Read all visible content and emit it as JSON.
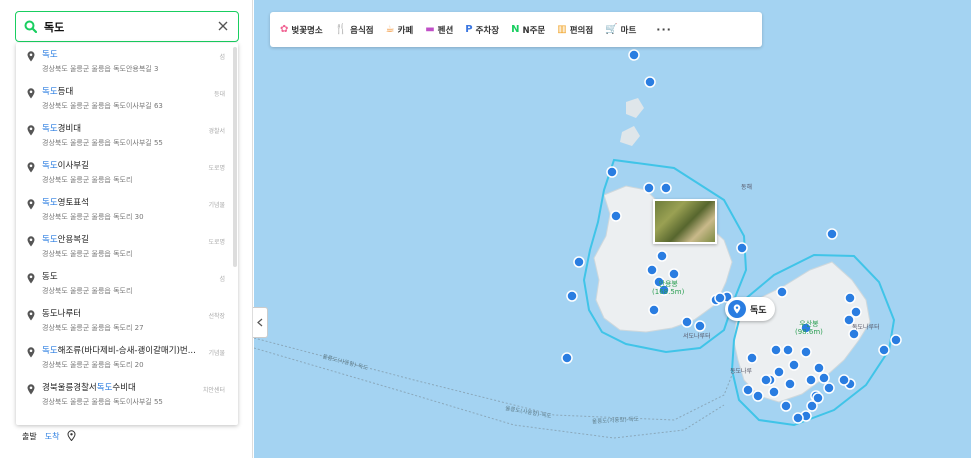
{
  "search": {
    "value": "독도"
  },
  "suggestions": [
    {
      "hl": "독도",
      "rest": "",
      "addr": "경상북도 울릉군 울릉읍 독도안용복길 3",
      "cat": "섬"
    },
    {
      "hl": "독도",
      "rest": "등대",
      "addr": "경상북도 울릉군 울릉읍 독도이사부길 63",
      "cat": "등대"
    },
    {
      "hl": "독도",
      "rest": "경비대",
      "addr": "경상북도 울릉군 울릉읍 독도이사부길 55",
      "cat": "경찰서"
    },
    {
      "hl": "독도",
      "rest": "이사부길",
      "addr": "경상북도 울릉군 울릉읍 독도리",
      "cat": "도로명"
    },
    {
      "hl": "독도",
      "rest": "영토표석",
      "addr": "경상북도 울릉군 울릉읍 독도리 30",
      "cat": "기념물"
    },
    {
      "hl": "독도",
      "rest": "안용복길",
      "addr": "경상북도 울릉군 울릉읍 독도리",
      "cat": "도로명"
    },
    {
      "pre": "동도",
      "hl": "",
      "rest": "",
      "addr": "경상북도 울릉군 울릉읍 독도리",
      "cat": "섬"
    },
    {
      "pre": "동도나루터",
      "hl": "",
      "rest": "",
      "addr": "경상북도 울릉군 울릉읍 독도리 27",
      "cat": "선착장"
    },
    {
      "hl": "독도",
      "rest": "해조류(바다제비-승새-괭이갈매기)번...",
      "addr": "경상북도 울릉군 울릉읍 독도리 20",
      "cat": "기념물"
    },
    {
      "pre": "경북울릉경찰서",
      "hl": "독도",
      "rest": "수비대",
      "addr": "경상북도 울릉군 울릉읍 독도이사부길 55",
      "cat": "치안센터"
    }
  ],
  "bottom_nav": {
    "depart": "출발",
    "arrive": "도착"
  },
  "categories": [
    {
      "label": "벚꽃명소",
      "icon": "cherry-blossom-icon",
      "glyph": "✿",
      "color": "#f06292"
    },
    {
      "label": "음식점",
      "icon": "fork-knife-icon",
      "glyph": "🍴",
      "color": "#f08a24"
    },
    {
      "label": "카페",
      "icon": "coffee-cup-icon",
      "glyph": "☕",
      "color": "#f08a24"
    },
    {
      "label": "펜션",
      "icon": "bed-icon",
      "glyph": "▬",
      "color": "#c04fc7"
    },
    {
      "label": "주차장",
      "icon": "parking-icon",
      "glyph": "P",
      "color": "#3a76e0"
    },
    {
      "label": "N주문",
      "icon": "n-order-icon",
      "glyph": "N",
      "color": "#19ce60"
    },
    {
      "label": "편의점",
      "icon": "convenience-store-icon",
      "glyph": "▥",
      "color": "#f0a020"
    },
    {
      "label": "마트",
      "icon": "cart-icon",
      "glyph": "🛒",
      "color": "#f0a020"
    }
  ],
  "more_label": "···",
  "map": {
    "marker_label": "독도",
    "east_label": "동해",
    "peak_west": [
      "안용봉",
      "(168.5m)"
    ],
    "peak_east": [
      "우산봉",
      "(98.6m)"
    ],
    "west_island_label": "서도나루터",
    "east_island_label": "독도나루터",
    "east_dock_label": "동도나루",
    "route_labels": [
      "울릉도(사동항)-독도",
      "울릉도(사동항)-독도",
      "울릉도(저동항)-독도"
    ],
    "colors": {
      "sea": "#a4d3f2",
      "land": "#eceff1",
      "route": "#40c4e8",
      "poi": "#2a7de1"
    }
  }
}
